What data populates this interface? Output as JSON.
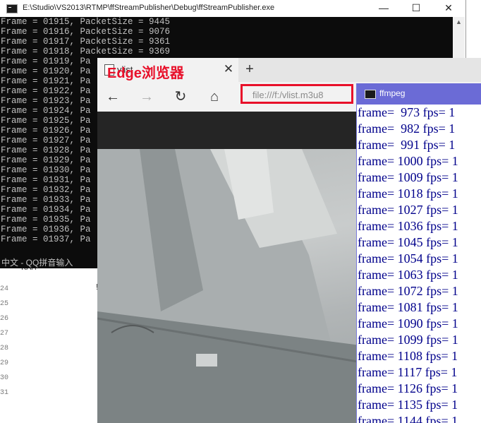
{
  "editor": {
    "line_numbers": [
      "24",
      "25",
      "26",
      "27",
      "28",
      "29",
      "30",
      "31"
    ],
    "fragment_top": "RAM",
    "fragment_mid": "!"
  },
  "console": {
    "title": "E:\\Studio\\VS2013\\RTMP\\ffStreamPublisher\\Debug\\ffStreamPublisher.exe",
    "minimize": "—",
    "maximize": "☐",
    "close": "✕",
    "lines": [
      "Frame = 01915, PacketSize = 9445",
      "Frame = 01916, PacketSize = 9076",
      "Frame = 01917, PacketSize = 9361",
      "Frame = 01918, PacketSize = 9369",
      "Frame = 01919, Pa",
      "Frame = 01920, Pa",
      "Frame = 01921, Pa",
      "Frame = 01922, Pa",
      "Frame = 01923, Pa",
      "Frame = 01924, Pa",
      "Frame = 01925, Pa",
      "Frame = 01926, Pa",
      "Frame = 01927, Pa",
      "Frame = 01928, Pa",
      "Frame = 01929, Pa",
      "Frame = 01930, Pa",
      "Frame = 01931, Pa",
      "Frame = 01932, Pa",
      "Frame = 01933, Pa",
      "Frame = 01934, Pa",
      "Frame = 01935, Pa",
      "Frame = 01936, Pa",
      "Frame = 01937, Pa"
    ],
    "ime_status": "中文 - QQ拼音输入"
  },
  "edge": {
    "overlay_label": "Edge浏览器",
    "tab_title": "vlist",
    "tab_close": "✕",
    "new_tab": "+",
    "back": "←",
    "forward": "→",
    "refresh": "↻",
    "home": "⌂",
    "address": "file:///f:/vlist.m3u8"
  },
  "ffmpeg": {
    "title": "ffmpeg",
    "lines": [
      "frame=  973 fps= 1",
      "frame=  982 fps= 1",
      "frame=  991 fps= 1",
      "frame= 1000 fps= 1",
      "frame= 1009 fps= 1",
      "frame= 1018 fps= 1",
      "frame= 1027 fps= 1",
      "frame= 1036 fps= 1",
      "frame= 1045 fps= 1",
      "frame= 1054 fps= 1",
      "frame= 1063 fps= 1",
      "frame= 1072 fps= 1",
      "frame= 1081 fps= 1",
      "frame= 1090 fps= 1",
      "frame= 1099 fps= 1",
      "frame= 1108 fps= 1",
      "frame= 1117 fps= 1",
      "frame= 1126 fps= 1",
      "frame= 1135 fps= 1",
      "frame= 1144 fps= 1"
    ]
  },
  "colors": {
    "console_bg": "#0c0c0c",
    "console_text": "#c0c0c0",
    "highlight_red": "#e8102a",
    "ffmpeg_title_bg": "#6b6bd6",
    "ffmpeg_text": "#00008b"
  }
}
